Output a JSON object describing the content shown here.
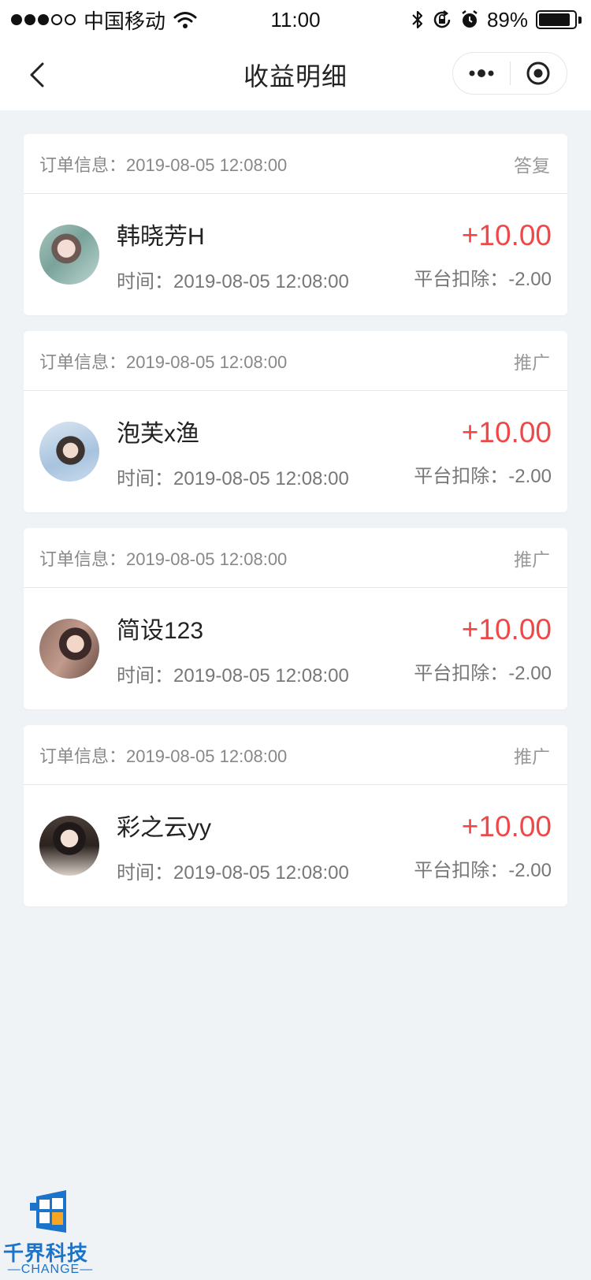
{
  "status_bar": {
    "carrier": "中国移动",
    "time": "11:00",
    "battery": "89%",
    "battery_level": 0.89,
    "signal_filled": 3,
    "signal_total": 5
  },
  "nav": {
    "title": "收益明细"
  },
  "colors": {
    "amount": "#f04848",
    "background": "#f0f3f6",
    "logo": "#1b74c9"
  },
  "records": [
    {
      "order_info": "订单信息：2019-08-05 12:08:00",
      "type": "答复",
      "name": "韩晓芳H",
      "time": "时间：2019-08-05 12:08:00",
      "amount": "+10.00",
      "fee": "平台扣除：-2.00"
    },
    {
      "order_info": "订单信息：2019-08-05 12:08:00",
      "type": "推广",
      "name": "泡芙x渔",
      "time": "时间：2019-08-05 12:08:00",
      "amount": "+10.00",
      "fee": "平台扣除：-2.00"
    },
    {
      "order_info": "订单信息：2019-08-05 12:08:00",
      "type": "推广",
      "name": "简设123",
      "time": "时间：2019-08-05 12:08:00",
      "amount": "+10.00",
      "fee": "平台扣除：-2.00"
    },
    {
      "order_info": "订单信息：2019-08-05 12:08:00",
      "type": "推广",
      "name": "彩之云yy",
      "time": "时间：2019-08-05 12:08:00",
      "amount": "+10.00",
      "fee": "平台扣除：-2.00"
    }
  ],
  "watermark": {
    "name_cn": "千界科技",
    "name_en": "—CHANGE—"
  }
}
